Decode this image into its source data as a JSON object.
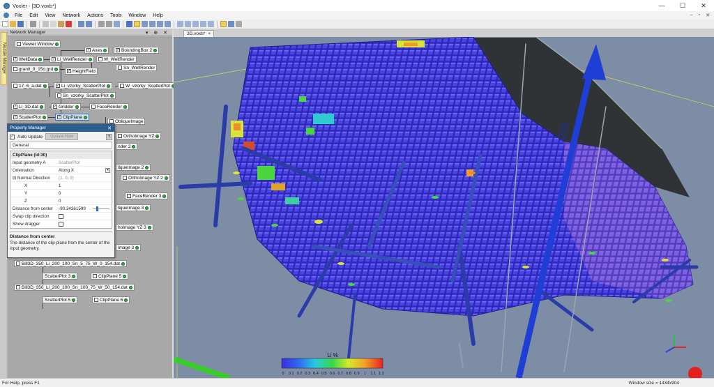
{
  "window": {
    "title": "Voxler - [3D.voxb*]",
    "controls": [
      "—",
      "☐",
      "✕"
    ]
  },
  "menu": {
    "items": [
      "File",
      "Edit",
      "View",
      "Network",
      "Actions",
      "Tools",
      "Window",
      "Help"
    ],
    "mdi_controls": [
      "–",
      "▫",
      "✕"
    ]
  },
  "module_strip": {
    "tab_label": "Module Manager"
  },
  "network_manager": {
    "title": "Network Manager",
    "header_controls": "▾ ⊕ ✕",
    "nodes": {
      "viewer_window": "Viewer Window",
      "axes": "Axes",
      "bounding_box": "BoundingBox 2",
      "well_data": "WellData",
      "li_well_render": "Li_WellRender",
      "w_well_render": "W_WellRender",
      "sn_well_render": "Sn_WellRender",
      "granit": "granit_9_15o.grd",
      "height_field": "HeightField",
      "a17_6": "17_6_a.dat",
      "li_scatter": "Li_vzorky_ScatterPlot",
      "w_scatter": "W_vzorky_ScatterPlot",
      "sn_scatter": "Sn_vzorky_ScatterPlot",
      "li_3d": "Li_3D.dat",
      "gridder": "Gridder",
      "face_render": "FaceRender",
      "scatter_plot": "ScatterPlot",
      "clip_plane": "ClipPlane",
      "oblique_image": "ObliqueImage",
      "ortho_yz": "OrthoImage YZ",
      "render2": "nder 2",
      "oblique2": "liqueImage 2",
      "ortho_yz2": "OrthoImage YZ 2",
      "face_render3": "FaceRender 3",
      "oblique3": "liqueImage 3",
      "ortho_yz3": "hoImage YZ 3",
      "oblique4": "image 3",
      "bill1": "Bill3D_350_Li_200_100_Sn_5_75_W_0_154.dat",
      "scatter3": "ScatterPlot 3",
      "clip5": "ClipPlane 5",
      "bill2": "Bill3D_350_Li_200_100_Sn_100_75_W_50_154.dat",
      "scatter5": "ScatterPlot 5",
      "clip6": "ClipPlane 6"
    }
  },
  "property_manager": {
    "title": "Property Manager",
    "auto_update": "Auto Update",
    "update_now": "Update Now",
    "help": "?",
    "tab": "General",
    "section": "ClipPlane (id:30)",
    "rows": {
      "input_geometry_k": "Input geometry A",
      "input_geometry_v": "ScatterPlot",
      "orientation_k": "Orientation",
      "orientation_v": "Along X",
      "normal_k": "Normal Direction",
      "normal_v": "(1, 0, 0)",
      "x_k": "X",
      "x_v": "1",
      "y_k": "Y",
      "y_v": "0",
      "z_k": "Z",
      "z_v": "0",
      "distance_k": "Distance from center",
      "distance_v": "-90.34361599",
      "swap_k": "Swap clip direction",
      "dragger_k": "Show dragger"
    },
    "desc_title": "Distance from center",
    "desc_text": "The distance of the clip plane from the center of the input geometry."
  },
  "viewer": {
    "tab_label": "3D.voxb*",
    "tab_close": "×",
    "axis_label": "Q03",
    "legend": {
      "title": "Li %",
      "ticks": [
        "0",
        "0.1",
        "0.2",
        "0.3",
        "0.4",
        "0.5",
        "0.6",
        "0.7",
        "0.8",
        "0.9",
        "1",
        "1.1",
        "1.2"
      ]
    }
  },
  "colors": {
    "accent": "#2b5d8f",
    "viewport_bg": "#7d8da6",
    "voxel_blue": "#3b36d6",
    "voxel_purple": "#7b5cdc",
    "node_ok": "#2fa843"
  },
  "status": {
    "left": "For Help, press F1",
    "right": "Window size = 1434x904"
  }
}
